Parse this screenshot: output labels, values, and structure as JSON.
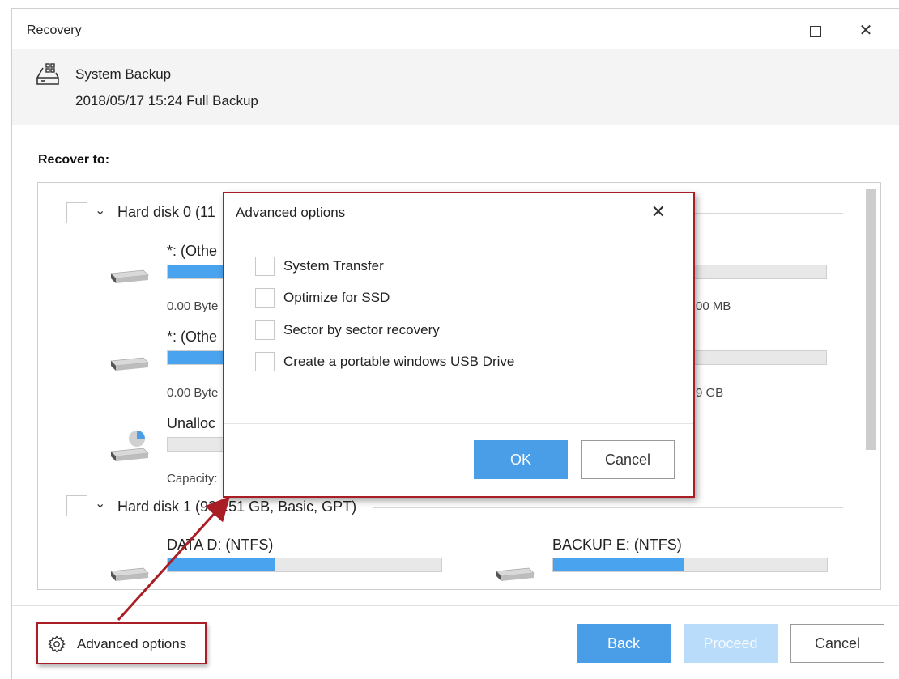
{
  "window": {
    "title": "Recovery",
    "maximize_icon": "maximize-icon",
    "close_icon": "close-icon",
    "close_glyph": "✕"
  },
  "backup": {
    "icon": "system-backup-icon",
    "name": "System Backup",
    "date": "2018/05/17 15:24 Full Backup"
  },
  "recover_to_label": "Recover to:",
  "disks": [
    {
      "title": "Hard disk 0 (11",
      "partitions": [
        {
          "name": "*: (Othe",
          "size_left": "0.00 Byte",
          "size_right": "00 MB",
          "fill": 0.3
        },
        {
          "name": "*: (Othe",
          "size_left": "0.00 Byte",
          "size_right": "9 GB",
          "fill": 0.3
        },
        {
          "name": "Unalloc",
          "size_left": "Capacity:",
          "fill": 0
        }
      ]
    },
    {
      "title": "Hard disk 1 (931.51 GB, Basic, GPT)",
      "partitions": [
        {
          "name": "DATA D: (NTFS)",
          "fill": 0.39
        },
        {
          "name": "BACKUP E: (NTFS)",
          "fill": 0.48
        }
      ]
    }
  ],
  "footer": {
    "advanced_options_label": "Advanced options",
    "gear_icon": "gear-icon",
    "back_label": "Back",
    "proceed_label": "Proceed",
    "cancel_label": "Cancel"
  },
  "dialog": {
    "title": "Advanced options",
    "close_glyph": "✕",
    "options": [
      {
        "label": "System Transfer",
        "checked": false
      },
      {
        "label": "Optimize for SSD",
        "checked": false
      },
      {
        "label": "Sector by sector recovery",
        "checked": false
      },
      {
        "label": "Create a portable windows USB Drive",
        "checked": false
      }
    ],
    "ok_label": "OK",
    "cancel_label": "Cancel"
  },
  "colors": {
    "accent": "#4a9ee8",
    "annotation_red": "#a91d24",
    "disabled_button": "#b8dcfa"
  }
}
